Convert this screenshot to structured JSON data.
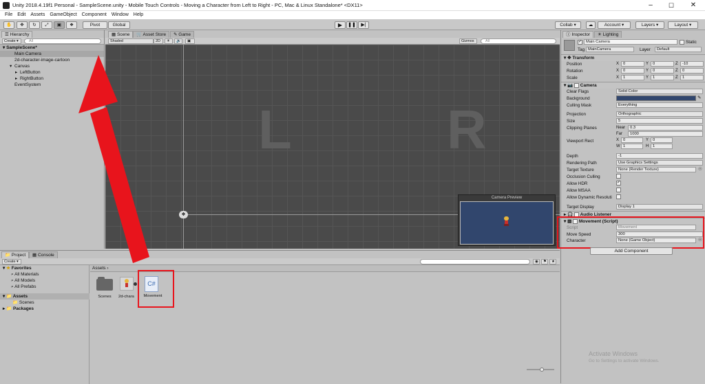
{
  "window": {
    "title": "Unity 2018.4.19f1 Personal - SampleScene.unity - Mobile Touch Controls - Moving a Character from Left to Right - PC, Mac & Linux Standalone* <DX11>"
  },
  "menu": [
    "File",
    "Edit",
    "Assets",
    "GameObject",
    "Component",
    "Window",
    "Help"
  ],
  "toolbar": {
    "pivot": "Pivot",
    "global": "Global",
    "collab": "Collab",
    "account": "Account",
    "layers": "Layers",
    "layout": "Layout"
  },
  "hierarchy": {
    "tab": "Hierarchy",
    "create": "Create",
    "search": "All",
    "scene": "SampleScene*",
    "items": [
      {
        "label": "Main Camera",
        "indent": 1
      },
      {
        "label": "2d-character-image-cartoon",
        "indent": 1
      },
      {
        "label": "Canvas",
        "indent": 1
      },
      {
        "label": "LeftButton",
        "indent": 2
      },
      {
        "label": "RightButton",
        "indent": 2
      },
      {
        "label": "EventSystem",
        "indent": 1
      }
    ]
  },
  "scene": {
    "tabs": [
      "Scene",
      "Asset Store",
      "Game"
    ],
    "shading": "Shaded",
    "mode2d": "2D",
    "gizmos": "Gizmos",
    "search": "All",
    "left_letter": "L",
    "right_letter": "R",
    "preview_title": "Camera Preview"
  },
  "project": {
    "tabs": [
      "Project",
      "Console"
    ],
    "create": "Create",
    "breadcrumb": "Assets",
    "favorites_label": "Favorites",
    "favorites": [
      "All Materials",
      "All Models",
      "All Prefabs"
    ],
    "assets_label": "Assets",
    "assets_children": [
      "Scenes"
    ],
    "packages_label": "Packages",
    "files": [
      {
        "name": "Scenes"
      },
      {
        "name": "2d-chara"
      },
      {
        "name": "Movement",
        "glyph": "C#"
      }
    ]
  },
  "inspector": {
    "tabs": [
      "Inspector",
      "Lighting"
    ],
    "object_name": "Main Camera",
    "static_label": "Static",
    "tag_label": "Tag",
    "tag": "MainCamera",
    "layer_label": "Layer",
    "layer": "Default",
    "transform": {
      "title": "Transform",
      "rows": [
        {
          "label": "Position",
          "x": "0",
          "y": "0",
          "z": "-10"
        },
        {
          "label": "Rotation",
          "x": "0",
          "y": "0",
          "z": "0"
        },
        {
          "label": "Scale",
          "x": "1",
          "y": "1",
          "z": "1"
        }
      ]
    },
    "camera": {
      "title": "Camera",
      "clear_flags_label": "Clear Flags",
      "clear_flags": "Solid Color",
      "background_label": "Background",
      "background_color": "#31466d",
      "culling_label": "Culling Mask",
      "culling": "Everything",
      "projection_label": "Projection",
      "projection": "Orthographic",
      "size_label": "Size",
      "size": "5",
      "clipping_label": "Clipping Planes",
      "near_label": "Near",
      "near": "0.3",
      "far_label": "Far",
      "far": "1000",
      "viewport_label": "Viewport Rect",
      "vx": "0",
      "vy": "0",
      "vw": "1",
      "vh": "1",
      "depth_label": "Depth",
      "depth": "-1",
      "rendering_label": "Rendering Path",
      "rendering": "Use Graphics Settings",
      "target_tex_label": "Target Texture",
      "target_tex": "None (Render Texture)",
      "occlusion_label": "Occlusion Culling",
      "hdr_label": "Allow HDR",
      "msaa_label": "Allow MSAA",
      "dyn_label": "Allow Dynamic Resoluti",
      "target_display_label": "Target Display",
      "target_display": "Display 1"
    },
    "audio_title": "Audio Listener",
    "movement": {
      "title": "Movement (Script)",
      "script_label": "Script",
      "script": "Movement",
      "speed_label": "Move Speed",
      "speed": "300",
      "char_label": "Character",
      "char": "None (Game Object)"
    },
    "add_component": "Add Component"
  },
  "watermark": {
    "line1": "Activate Windows",
    "line2": "Go to Settings to activate Windows."
  },
  "colors": {
    "annotation": "#e8141c",
    "scene_bg": "#4a4a4a",
    "preview_bg": "#31466d"
  }
}
